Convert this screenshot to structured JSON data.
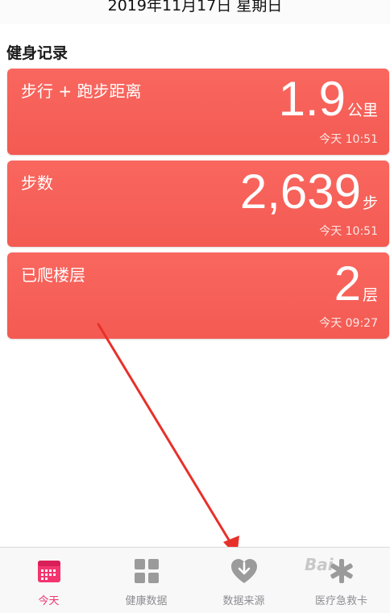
{
  "header": {
    "date": "2019年11月17日 星期日"
  },
  "section": {
    "title": "健身记录"
  },
  "cards": [
    {
      "label": "步行 + 跑步距离",
      "value": "1.9",
      "unit": "公里",
      "time": "今天 10:51"
    },
    {
      "label": "步数",
      "value": "2,639",
      "unit": "步",
      "time": "今天 10:51"
    },
    {
      "label": "已爬楼层",
      "value": "2",
      "unit": "层",
      "time": "今天 09:27"
    }
  ],
  "tabbar": {
    "items": [
      {
        "label": "今天",
        "icon": "calendar-icon",
        "active": true
      },
      {
        "label": "健康数据",
        "icon": "grid-icon",
        "active": false
      },
      {
        "label": "数据来源",
        "icon": "download-heart-icon",
        "active": false
      },
      {
        "label": "医疗急救卡",
        "icon": "asterisk-icon",
        "active": false
      }
    ]
  },
  "watermark": {
    "text": "Bai"
  },
  "colors": {
    "card": "#f35a52",
    "active_tab": "#f2356e",
    "inactive_tab": "#8e8e93",
    "arrow": "#e8302a"
  }
}
